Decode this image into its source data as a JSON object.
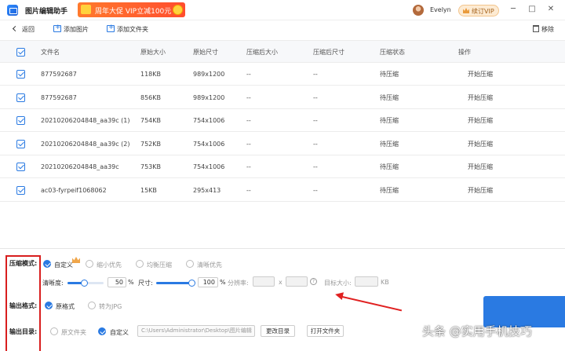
{
  "app": {
    "title": "图片编辑助手",
    "banner": "周年大促 VIP立减100元",
    "username": "Evelyn",
    "vip_button": "续订VIP",
    "window_controls": [
      "─",
      "□",
      "✕"
    ]
  },
  "toolbar": {
    "back": "返回",
    "add_image": "添加图片",
    "add_folder": "添加文件夹",
    "remove": "移除"
  },
  "table": {
    "columns": [
      "文件名",
      "原始大小",
      "原始尺寸",
      "压缩后大小",
      "压缩后尺寸",
      "压缩状态",
      "操作"
    ],
    "rows": [
      {
        "name": "877592687",
        "size": "118KB",
        "dims": "989x1200",
        "new_size": "--",
        "new_dims": "--",
        "status": "待压缩",
        "action": "开始压缩"
      },
      {
        "name": "877592687",
        "size": "856KB",
        "dims": "989x1200",
        "new_size": "--",
        "new_dims": "--",
        "status": "待压缩",
        "action": "开始压缩"
      },
      {
        "name": "20210206204848_aa39c (1)",
        "size": "754KB",
        "dims": "754x1006",
        "new_size": "--",
        "new_dims": "--",
        "status": "待压缩",
        "action": "开始压缩"
      },
      {
        "name": "20210206204848_aa39c (2)",
        "size": "752KB",
        "dims": "754x1006",
        "new_size": "--",
        "new_dims": "--",
        "status": "待压缩",
        "action": "开始压缩"
      },
      {
        "name": "20210206204848_aa39c",
        "size": "753KB",
        "dims": "754x1006",
        "new_size": "--",
        "new_dims": "--",
        "status": "待压缩",
        "action": "开始压缩"
      },
      {
        "name": "ac03-fyrpeif1068062",
        "size": "15KB",
        "dims": "295x413",
        "new_size": "--",
        "new_dims": "--",
        "status": "待压缩",
        "action": "开始压缩"
      }
    ]
  },
  "settings": {
    "mode_label": "压缩模式:",
    "mode_options": [
      "自定义",
      "缩小优先",
      "均衡压缩",
      "清晰优先"
    ],
    "clarity_label": "清晰度:",
    "clarity_value": "50",
    "clarity_unit": "%",
    "clarity_level": 0.5,
    "size_label": "尺寸:",
    "size_value": "100",
    "size_unit": "%",
    "size_level": 1.0,
    "resolution_label": "分辨率:",
    "resolution_sep": "x",
    "target_label": "目标大小:",
    "target_unit": "KB",
    "format_label": "输出格式:",
    "format_options": [
      "原格式",
      "转为JPG"
    ],
    "dir_label": "输出目录:",
    "dir_options": [
      "原文件夹",
      "自定义"
    ],
    "dir_path": "C:\\Users\\Administrator\\Desktop\\图片编辑",
    "change_dir": "更改目录",
    "open_folder": "打开文件夹",
    "help_mark": "?"
  },
  "watermark": "头条 @实用手机技巧",
  "colors": {
    "accent": "#2a7ae2",
    "annotation": "#d81e1e"
  }
}
